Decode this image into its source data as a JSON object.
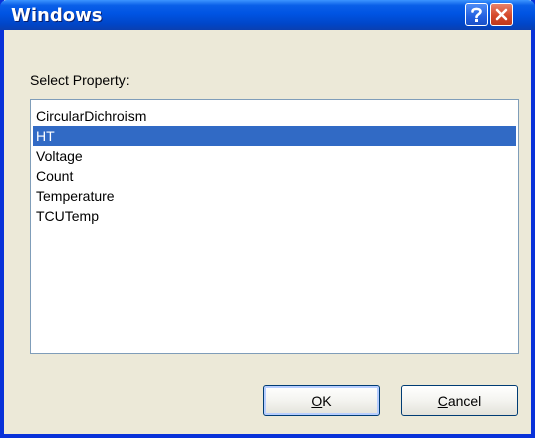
{
  "window": {
    "title": "Windows",
    "help_icon": "help-icon",
    "close_icon": "close-icon"
  },
  "dialog": {
    "label": "Select Property:",
    "properties": [
      "CircularDichroism",
      "HT",
      "Voltage",
      "Count",
      "Temperature",
      "TCUTemp"
    ],
    "selected": "HT"
  },
  "buttons": {
    "ok_mnemonic": "O",
    "ok_rest": "K",
    "cancel_mnemonic": "C",
    "cancel_rest": "ancel"
  },
  "colors": {
    "titlebar": "#0054e3",
    "selection": "#316ac5",
    "dialog_bg": "#ece9d8"
  }
}
